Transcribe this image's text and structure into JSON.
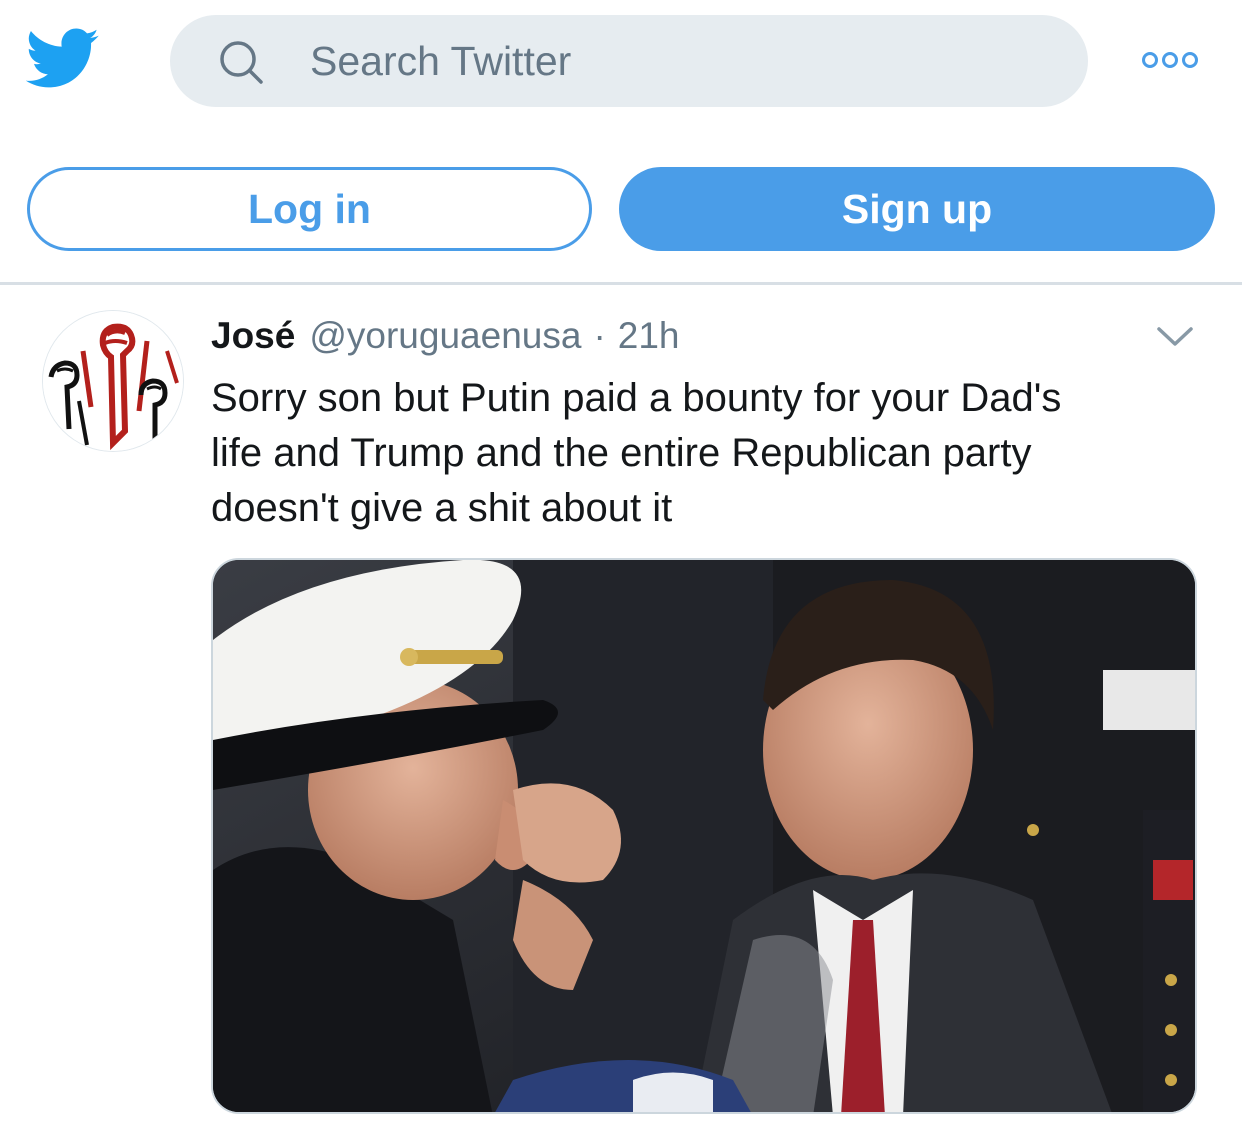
{
  "header": {
    "logo_icon": "twitter-bird-icon",
    "search": {
      "placeholder": "Search Twitter",
      "value": ""
    },
    "more_icon": "more-dots-icon"
  },
  "auth": {
    "login_label": "Log in",
    "signup_label": "Sign up"
  },
  "tweet": {
    "name": "José",
    "handle": "@yoruguaenusa",
    "separator": "·",
    "time": "21h",
    "text_lines": [
      "Sorry son but Putin paid a bounty for your Dad's",
      "life and Trump and the entire Republican party",
      "doesn't give a shit about it"
    ],
    "menu_icon": "chevron-down-icon",
    "avatar_icon": "raised-fists-avatar",
    "media_icon": "funeral-photo"
  },
  "colors": {
    "brand": "#1da1f2",
    "button_blue": "#4a9de8",
    "secondary_text": "#657786",
    "search_bg": "#e6ecf0"
  }
}
